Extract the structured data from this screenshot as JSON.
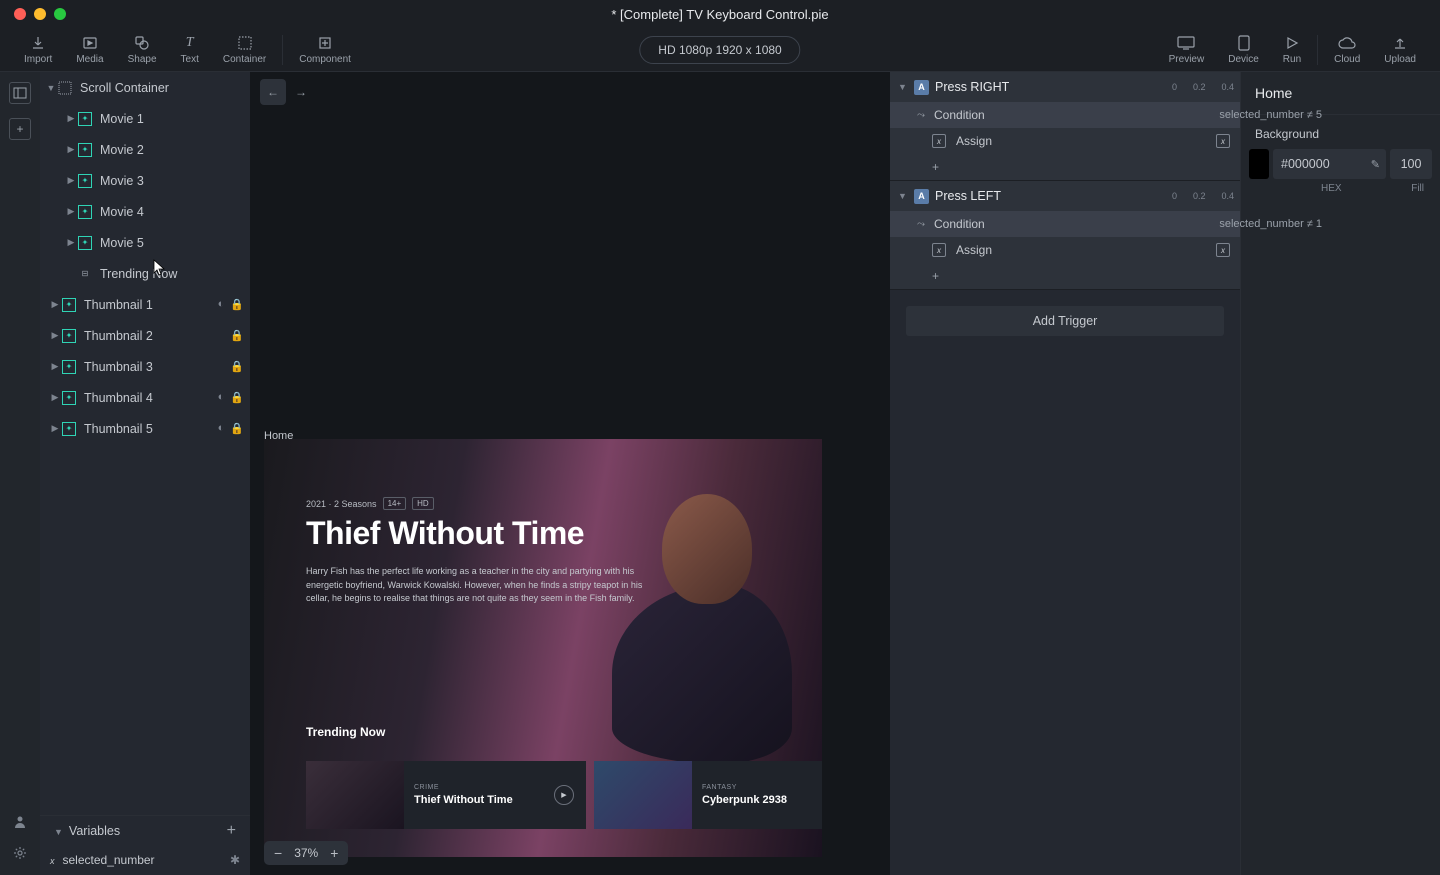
{
  "title": "* [Complete] TV Keyboard Control.pie",
  "toolbar": {
    "left": [
      {
        "label": "Import",
        "icon": "↓"
      },
      {
        "label": "Media",
        "icon": "▸"
      },
      {
        "label": "Shape",
        "icon": "⬠"
      },
      {
        "label": "Text",
        "icon": "T"
      },
      {
        "label": "Container",
        "icon": "▦"
      },
      {
        "label": "Component",
        "icon": "⊞",
        "sep_before": true
      }
    ],
    "resolution": "HD 1080p  1920 x 1080",
    "right": [
      {
        "label": "Preview",
        "icon": "▭"
      },
      {
        "label": "Device",
        "icon": "▯"
      },
      {
        "label": "Run",
        "icon": "▷"
      },
      {
        "label": "Cloud",
        "icon": "☁",
        "sep_before": true
      },
      {
        "label": "Upload",
        "icon": "↑"
      }
    ]
  },
  "hierarchy": {
    "root": "Scroll Container",
    "movies": [
      "Movie 1",
      "Movie 2",
      "Movie 3",
      "Movie 4",
      "Movie 5"
    ],
    "trending_label": "Trending Now",
    "thumbnails": [
      "Thumbnail 1",
      "Thumbnail 2",
      "Thumbnail 3",
      "Thumbnail 4",
      "Thumbnail 5"
    ]
  },
  "variables": {
    "header": "Variables",
    "items": [
      "selected_number"
    ]
  },
  "canvas": {
    "home_label": "Home",
    "selected_chip": "selected_number",
    "hero_meta_year": "2021 · 2 Seasons",
    "hero_meta_age": "14+",
    "hero_meta_hd": "HD",
    "hero_title": "Thief Without Time",
    "hero_desc": "Harry Fish has the perfect life working as a teacher in the city and partying with his energetic boyfriend, Warwick Kowalski. However, when he finds a stripy teapot in his cellar, he begins to realise that things are not quite as they seem in the Fish family.",
    "trending_heading": "Trending Now",
    "cards": [
      {
        "cat": "CRIME",
        "title": "Thief Without Time"
      },
      {
        "cat": "FANTASY",
        "title": "Cyberpunk 2938"
      }
    ],
    "zoom": "37%"
  },
  "triggers": [
    {
      "name": "Press RIGHT",
      "note": "selected_number ≠ 5",
      "ticks": [
        "0",
        "0.2",
        "0.4"
      ],
      "rows": [
        {
          "type": "cond",
          "label": "Condition"
        },
        {
          "type": "assign",
          "label": "Assign"
        },
        {
          "type": "add",
          "label": "+"
        }
      ]
    },
    {
      "name": "Press LEFT",
      "note": "selected_number ≠ 1",
      "ticks": [
        "0",
        "0.2",
        "0.4"
      ],
      "rows": [
        {
          "type": "cond",
          "label": "Condition"
        },
        {
          "type": "assign",
          "label": "Assign"
        },
        {
          "type": "add",
          "label": "+"
        }
      ]
    }
  ],
  "add_trigger": "Add Trigger",
  "inspector": {
    "title": "Home",
    "bg_label": "Background",
    "hex": "#000000",
    "fill": "100",
    "hex_label": "HEX",
    "fill_label": "Fill"
  }
}
